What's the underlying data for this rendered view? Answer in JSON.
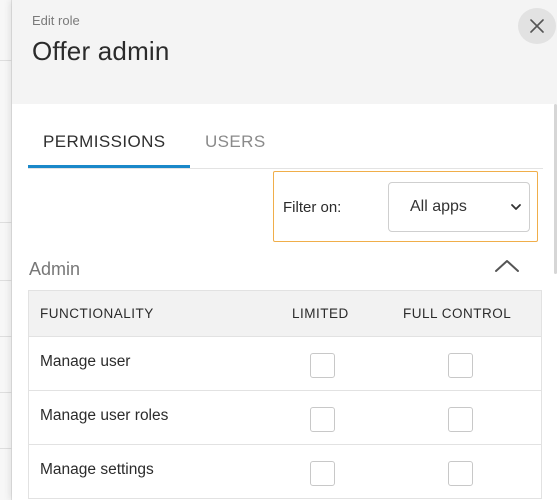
{
  "header": {
    "subtitle": "Edit role",
    "title": "Offer admin"
  },
  "tabs": [
    {
      "label": "PERMISSIONS",
      "active": true
    },
    {
      "label": "USERS",
      "active": false
    }
  ],
  "filter": {
    "label": "Filter on:",
    "selected": "All apps"
  },
  "section": {
    "title": "Admin",
    "expanded": true
  },
  "table": {
    "headers": {
      "functionality": "FUNCTIONALITY",
      "limited": "LIMITED",
      "full_control": "FULL CONTROL"
    },
    "rows": [
      {
        "label": "Manage user",
        "limited": false,
        "full_control": false
      },
      {
        "label": "Manage user roles",
        "limited": false,
        "full_control": false
      },
      {
        "label": "Manage settings",
        "limited": false,
        "full_control": false
      }
    ]
  },
  "colors": {
    "accent": "#1a88c9",
    "filter_highlight": "#f0ae4a"
  },
  "icons": {
    "close": "close-icon",
    "select_chevron": "chevron-down-icon",
    "collapse": "chevron-up-icon"
  }
}
